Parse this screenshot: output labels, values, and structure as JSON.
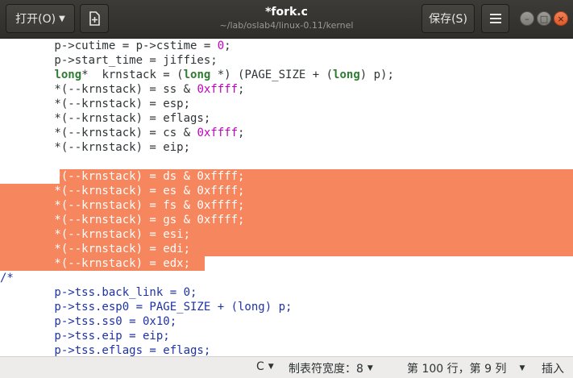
{
  "window": {
    "title": "*fork.c",
    "subtitle": "~/lab/oslab4/linux-0.11/kernel"
  },
  "toolbar": {
    "open_label": "打开(O)",
    "save_label": "保存(S)",
    "menu_icon": "hamburger-menu-icon",
    "new_tab_icon": "new-document-icon"
  },
  "window_controls": {
    "minimize": "–",
    "maximize": "□",
    "close": "×"
  },
  "editor": {
    "lines": [
      {
        "tokens": [
          {
            "t": "        p->cutime = p->cstime = "
          },
          {
            "t": "0",
            "c": "lit"
          },
          {
            "t": ";"
          }
        ]
      },
      {
        "tokens": [
          {
            "t": "        p->start_time = jiffies;"
          }
        ]
      },
      {
        "tokens": [
          {
            "t": "        "
          },
          {
            "t": "long",
            "c": "kw"
          },
          {
            "t": "*  krnstack = ("
          },
          {
            "t": "long",
            "c": "kw"
          },
          {
            "t": " *) (PAGE_SIZE + ("
          },
          {
            "t": "long",
            "c": "kw"
          },
          {
            "t": ") p);"
          }
        ]
      },
      {
        "tokens": [
          {
            "t": "        *(--krnstack) = ss & "
          },
          {
            "t": "0xffff",
            "c": "hex"
          },
          {
            "t": ";"
          }
        ]
      },
      {
        "tokens": [
          {
            "t": "        *(--krnstack) = esp;"
          }
        ]
      },
      {
        "tokens": [
          {
            "t": "        *(--krnstack) = eflags;"
          }
        ]
      },
      {
        "tokens": [
          {
            "t": "        *(--krnstack) = cs & "
          },
          {
            "t": "0xffff",
            "c": "hex"
          },
          {
            "t": ";"
          }
        ]
      },
      {
        "tokens": [
          {
            "t": "        *(--krnstack) = eip;"
          }
        ]
      },
      {
        "tokens": [
          {
            "t": ""
          }
        ]
      },
      {
        "selected": true,
        "tokens": [
          {
            "t": "        *(--krnstack) = ds & 0xffff;"
          }
        ]
      },
      {
        "selected": true,
        "tokens": [
          {
            "t": "        *(--krnstack) = es & 0xffff;"
          }
        ]
      },
      {
        "selected": true,
        "tokens": [
          {
            "t": "        *(--krnstack) = fs & 0xffff;"
          }
        ]
      },
      {
        "selected": true,
        "tokens": [
          {
            "t": "        *(--krnstack) = gs & 0xffff;"
          }
        ]
      },
      {
        "selected": true,
        "tokens": [
          {
            "t": "        *(--krnstack) = esi;"
          }
        ]
      },
      {
        "selected": true,
        "tokens": [
          {
            "t": "        *(--krnstack) = edi;"
          }
        ]
      },
      {
        "selected": true,
        "tokens": [
          {
            "t": "        *(--krnstack) = edx;"
          }
        ]
      },
      {
        "tokens": [
          {
            "t": "/*",
            "c": "cmt"
          }
        ]
      },
      {
        "tokens": [
          {
            "t": "        p->tss.back_link = 0;",
            "c": "cmt"
          }
        ]
      },
      {
        "tokens": [
          {
            "t": "        p->tss.esp0 = PAGE_SIZE + (long) p;",
            "c": "cmt"
          }
        ]
      },
      {
        "tokens": [
          {
            "t": "        p->tss.ss0 = 0x10;",
            "c": "cmt"
          }
        ]
      },
      {
        "tokens": [
          {
            "t": "        p->tss.eip = eip;",
            "c": "cmt"
          }
        ]
      },
      {
        "tokens": [
          {
            "t": "        p->tss.eflags = eflags;",
            "c": "cmt"
          }
        ]
      }
    ]
  },
  "statusbar": {
    "language": "C",
    "tab_width": "制表符宽度：8",
    "position": "第 100 行，第 9 列",
    "mode": "插入"
  }
}
